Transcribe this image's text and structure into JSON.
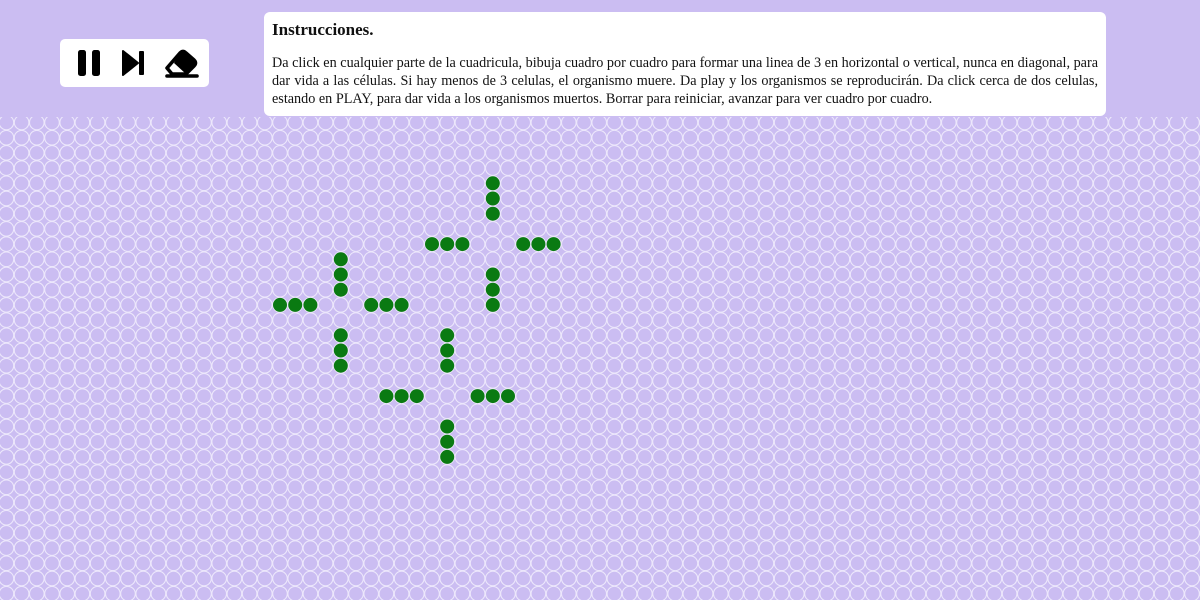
{
  "toolbar": {
    "buttons": [
      {
        "name": "pause",
        "icon": "pause-icon"
      },
      {
        "name": "step",
        "icon": "skip-forward-icon"
      },
      {
        "name": "erase",
        "icon": "eraser-icon"
      }
    ]
  },
  "instructions": {
    "title": "Instrucciones.",
    "text": "Da click en cualquier parte de la cuadricula, bibuja cuadro por cuadro para formar una linea de 3 en horizontal o vertical, nunca en diagonal, para dar vida a las células. Si hay menos de 3 celulas, el organismo muere. Da play y los organismos se reproducirán. Da click cerca de dos celulas, estando en PLAY, para dar vida a los organismos muertos. Borrar para reiniciar, avanzar para ver cuadro por cuadro."
  },
  "grid": {
    "background_color": "#cbbdf2",
    "cell_outline_color": "#ece7fb",
    "live_cell_color": "#0a7a12",
    "live_cells": [
      [
        32,
        4
      ],
      [
        32,
        5
      ],
      [
        32,
        6
      ],
      [
        28,
        8
      ],
      [
        29,
        8
      ],
      [
        30,
        8
      ],
      [
        34,
        8
      ],
      [
        35,
        8
      ],
      [
        36,
        8
      ],
      [
        22,
        9
      ],
      [
        22,
        10
      ],
      [
        22,
        11
      ],
      [
        32,
        10
      ],
      [
        32,
        11
      ],
      [
        32,
        12
      ],
      [
        18,
        12
      ],
      [
        19,
        12
      ],
      [
        20,
        12
      ],
      [
        24,
        12
      ],
      [
        25,
        12
      ],
      [
        26,
        12
      ],
      [
        22,
        14
      ],
      [
        22,
        15
      ],
      [
        22,
        16
      ],
      [
        29,
        14
      ],
      [
        29,
        15
      ],
      [
        29,
        16
      ],
      [
        25,
        18
      ],
      [
        26,
        18
      ],
      [
        27,
        18
      ],
      [
        31,
        18
      ],
      [
        32,
        18
      ],
      [
        33,
        18
      ],
      [
        29,
        20
      ],
      [
        29,
        21
      ],
      [
        29,
        22
      ]
    ]
  }
}
